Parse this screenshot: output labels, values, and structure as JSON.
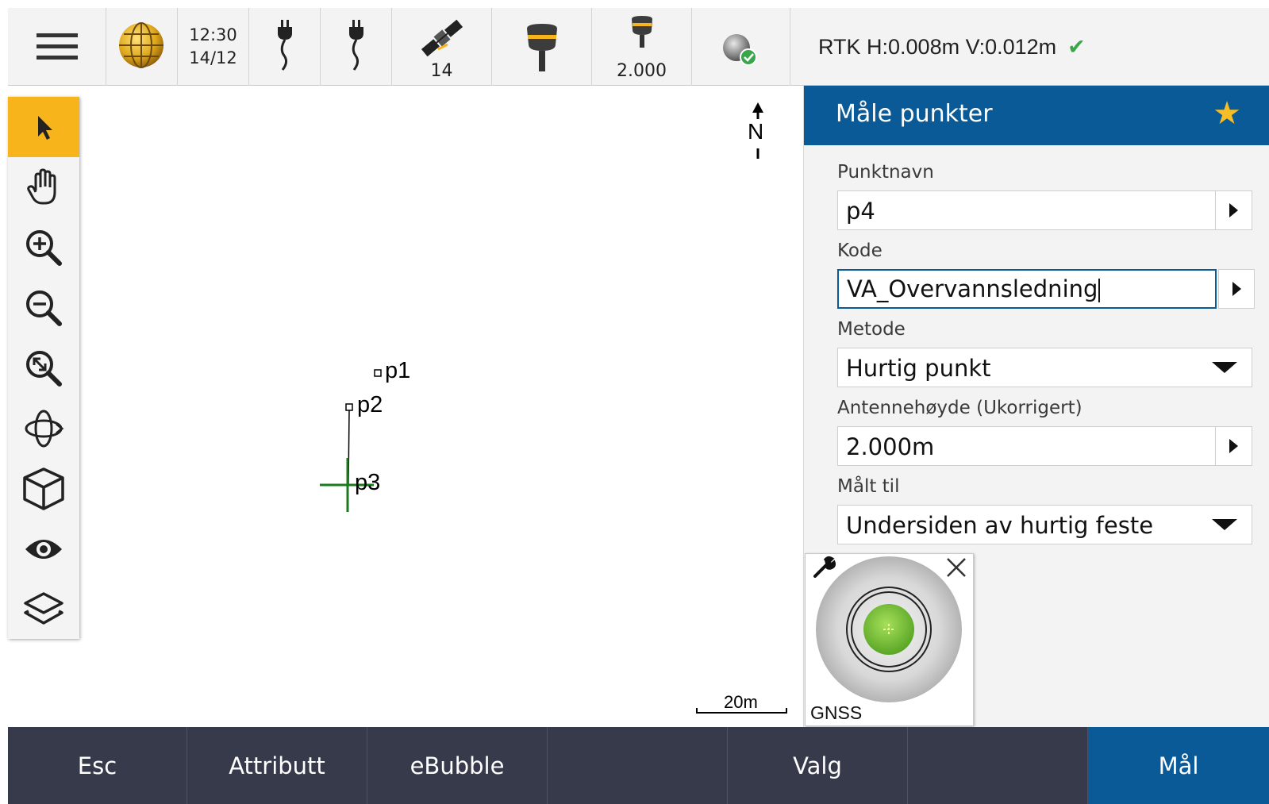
{
  "statusbar": {
    "time": "12:30",
    "date": "14/12",
    "satellites": "14",
    "antenna_height": "2.000",
    "precision": "RTK H:0.008m V:0.012m"
  },
  "map": {
    "points": [
      {
        "label": "p1"
      },
      {
        "label": "p2"
      },
      {
        "label": "p3"
      }
    ],
    "north_label": "N",
    "scale_label": "20m"
  },
  "panel": {
    "title": "Måle punkter",
    "fields": {
      "punktnavn": {
        "label": "Punktnavn",
        "value": "p4"
      },
      "kode": {
        "label": "Kode",
        "value": "VA_Overvannsledning"
      },
      "metode": {
        "label": "Metode",
        "value": "Hurtig punkt"
      },
      "antennehoyde": {
        "label": "Antennehøyde (Ukorrigert)",
        "value": "2.000m"
      },
      "malt_til": {
        "label": "Målt til",
        "value": "Undersiden av hurtig feste"
      }
    }
  },
  "bubble": {
    "label": "GNSS"
  },
  "softkeys": {
    "esc": "Esc",
    "attributt": "Attributt",
    "ebubble": "eBubble",
    "valg": "Valg",
    "mal": "Mål"
  },
  "colors": {
    "header_blue": "#0a5a98",
    "active_tool": "#f7b51b",
    "bottom_bar": "#363a4a",
    "check_green": "#3aa64a",
    "star_yellow": "#f6be26"
  },
  "icons": {
    "menu": "hamburger-menu-icon",
    "globe": "globe-icon",
    "power": "power-plug-icon",
    "satellite": "satellite-icon",
    "receiver": "gnss-receiver-icon",
    "status": "position-status-icon"
  }
}
